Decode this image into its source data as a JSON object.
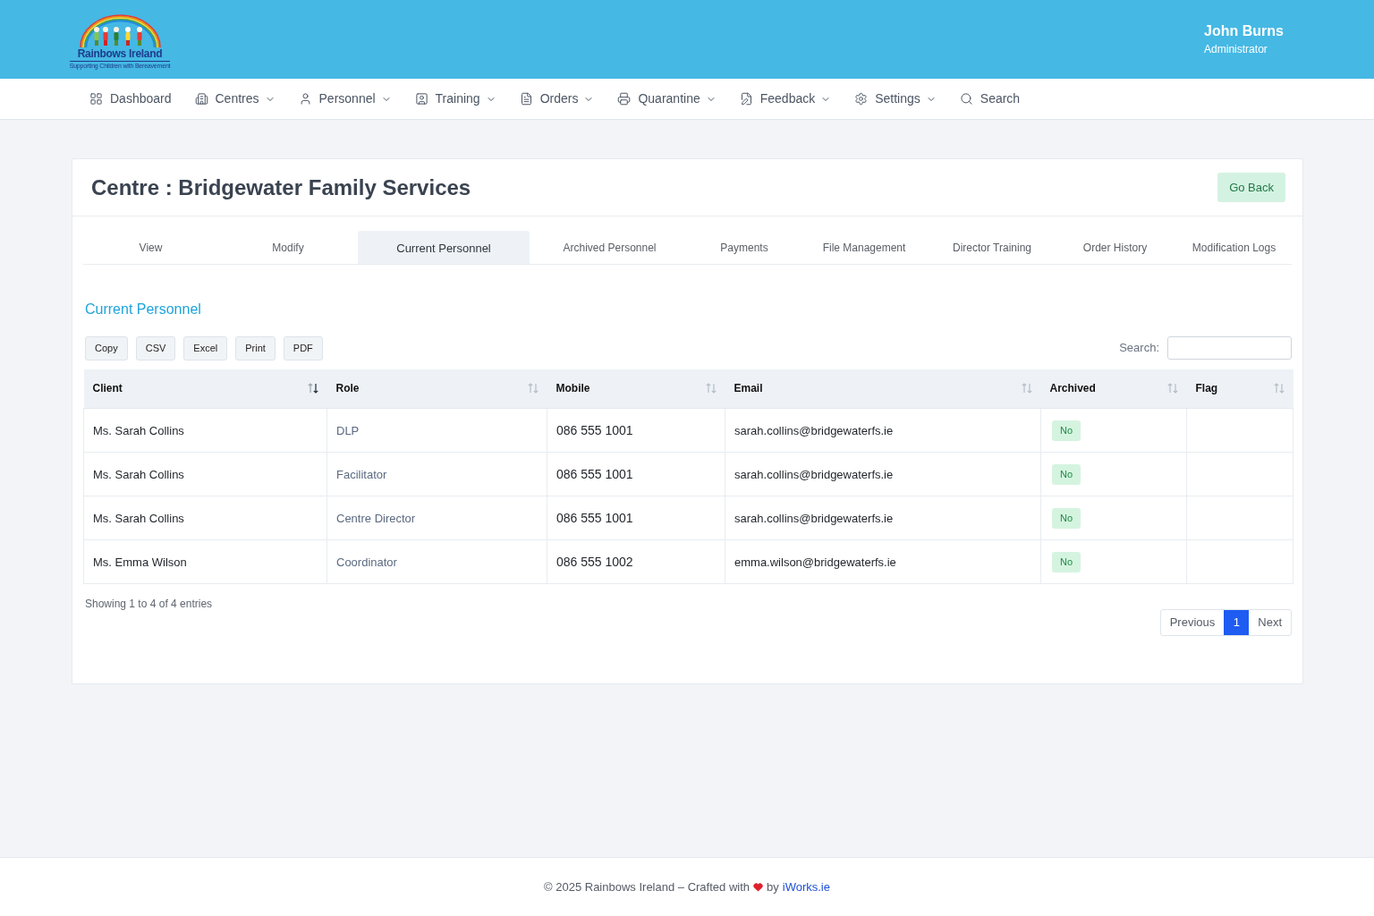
{
  "header": {
    "logo": {
      "title": "Rainbows Ireland",
      "tagline": "Supporting Children with Bereavement"
    },
    "user": {
      "name": "John Burns",
      "role": "Administrator"
    }
  },
  "nav": [
    {
      "label": "Dashboard",
      "dropdown": false
    },
    {
      "label": "Centres",
      "dropdown": true
    },
    {
      "label": "Personnel",
      "dropdown": true
    },
    {
      "label": "Training",
      "dropdown": true
    },
    {
      "label": "Orders",
      "dropdown": true
    },
    {
      "label": "Quarantine",
      "dropdown": true
    },
    {
      "label": "Feedback",
      "dropdown": true
    },
    {
      "label": "Settings",
      "dropdown": true
    },
    {
      "label": "Search",
      "dropdown": false
    }
  ],
  "page": {
    "title": "Centre : Bridgewater Family Services",
    "back_button": "Go Back"
  },
  "tabs": [
    {
      "label": "View",
      "selected": false
    },
    {
      "label": "Modify",
      "selected": false
    },
    {
      "label": "Current Personnel",
      "selected": true
    },
    {
      "label": "Archived Personnel",
      "selected": false
    },
    {
      "label": "Payments",
      "selected": false
    },
    {
      "label": "File Management",
      "selected": false
    },
    {
      "label": "Director Training",
      "selected": false
    },
    {
      "label": "Order History",
      "selected": false
    },
    {
      "label": "Modification Logs",
      "selected": false
    }
  ],
  "section_title": "Current Personnel",
  "export_buttons": [
    "Copy",
    "CSV",
    "Excel",
    "Print",
    "PDF"
  ],
  "search": {
    "label": "Search:"
  },
  "table": {
    "columns": [
      {
        "label": "Client",
        "sorted": true
      },
      {
        "label": "Role",
        "sorted": false
      },
      {
        "label": "Mobile",
        "sorted": false
      },
      {
        "label": "Email",
        "sorted": false
      },
      {
        "label": "Archived",
        "sorted": false
      },
      {
        "label": "Flag",
        "sorted": false
      }
    ],
    "rows": [
      {
        "client": "Ms. Sarah Collins",
        "role": "DLP",
        "mobile": "086 555 1001",
        "email": "sarah.collins@bridgewaterfs.ie",
        "archived": "No"
      },
      {
        "client": "Ms. Sarah Collins",
        "role": "Facilitator",
        "mobile": "086 555 1001",
        "email": "sarah.collins@bridgewaterfs.ie",
        "archived": "No"
      },
      {
        "client": "Ms. Sarah Collins",
        "role": "Centre Director",
        "mobile": "086 555 1001",
        "email": "sarah.collins@bridgewaterfs.ie",
        "archived": "No"
      },
      {
        "client": "Ms. Emma Wilson",
        "role": "Coordinator",
        "mobile": "086 555 1002",
        "email": "emma.wilson@bridgewaterfs.ie",
        "archived": "No"
      }
    ]
  },
  "table_info": "Showing 1 to 4 of 4 entries",
  "pagination": {
    "previous": "Previous",
    "pages": [
      {
        "label": "1",
        "selected": true
      }
    ],
    "next": "Next"
  },
  "footer": {
    "prefix": "© 2025 Rainbows Ireland – Crafted with",
    "by": "by",
    "link": "iWorks.ie"
  }
}
